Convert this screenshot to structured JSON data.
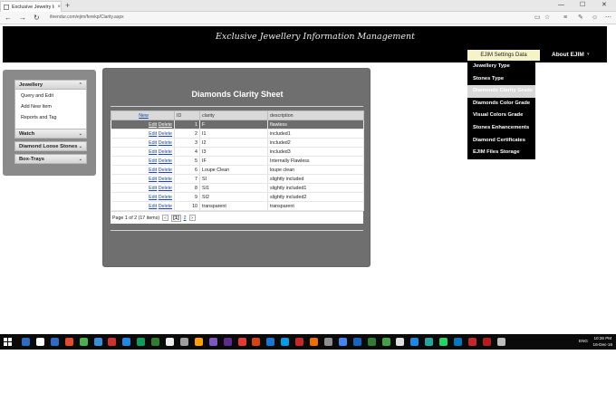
{
  "browser": {
    "tab_title": "Exclusive Jewelry Inform",
    "tab_close": "×",
    "new_tab": "+",
    "url": "ifeendur.com/ejim/ferekp/Clarity.aspx",
    "win_min": "—",
    "win_max": "☐",
    "win_close": "✕",
    "back": "←",
    "forward": "→",
    "refresh": "↻"
  },
  "header": {
    "site_title": "Exclusive Jewellery Information Management",
    "menu_settings": "EJIM Settings Data",
    "menu_about": "About EJIM",
    "menu_about_arrow": "▾"
  },
  "dropdown": {
    "items": [
      "Jewellery Type",
      "Stones Type",
      "Diamonds Clarity Grade",
      "Diamonds Color Grade",
      "Visual Colors Grade",
      "Stones Enhancements",
      "Diamond Certificates",
      "EJIM Files Storage"
    ],
    "selected_index": 2
  },
  "sidebar": {
    "jewellery": {
      "title": "Jewellery",
      "chevron": "⌃",
      "links": [
        "Query and Edit",
        "Add New Item",
        "Reports and Tag"
      ]
    },
    "watch": {
      "title": "Watch",
      "chevron": "⌄"
    },
    "loose": {
      "title": "Diamond Loose Stones",
      "chevron": "⌄"
    },
    "box": {
      "title": "Box-Trays",
      "chevron": "⌄"
    }
  },
  "panel": {
    "title": "Diamonds Clarity Sheet",
    "columns": {
      "new": "New",
      "id": "ID",
      "clarity": "clarity",
      "description": "description"
    },
    "edit_label": "Edit",
    "delete_label": "Delete",
    "rows": [
      {
        "id": "1",
        "clarity": "F",
        "description": "flawless"
      },
      {
        "id": "2",
        "clarity": "I1",
        "description": "included1"
      },
      {
        "id": "3",
        "clarity": "I2",
        "description": "included2"
      },
      {
        "id": "4",
        "clarity": "I3",
        "description": "included3"
      },
      {
        "id": "5",
        "clarity": "IF",
        "description": "Internally Flawless"
      },
      {
        "id": "6",
        "clarity": "Loupe Clean",
        "description": "loupe clean"
      },
      {
        "id": "7",
        "clarity": "SI",
        "description": "slightly included"
      },
      {
        "id": "8",
        "clarity": "SI1",
        "description": "slightly included1"
      },
      {
        "id": "9",
        "clarity": "SI2",
        "description": "slightly included2"
      },
      {
        "id": "10",
        "clarity": "transparent",
        "description": "transparent"
      }
    ],
    "selected_row": 0,
    "pager": {
      "summary": "Page 1 of 2 (17 items)",
      "prev": "<",
      "current": "[1]",
      "page2": "2",
      "next": ">"
    }
  },
  "taskbar": {
    "clock_time": "10:26 PM",
    "clock_date": "16-Dec-16",
    "lang": "ENG",
    "icon_colors": [
      "#2b6cc4",
      "#ffffff",
      "#2b6cc4",
      "#e34c26",
      "#4caf50",
      "#3b8edb",
      "#d32f2f",
      "#1e88e5",
      "#0f9d58",
      "#2e7d32",
      "#eeeeee",
      "#9e9e9e",
      "#ffa000",
      "#7e57c2",
      "#5c2d91",
      "#e53935",
      "#d84315",
      "#1976d2",
      "#039be5",
      "#c62828",
      "#ef6c00",
      "#8e8e8e",
      "#4285f4",
      "#1565c0",
      "#2e7d32",
      "#43a047",
      "#e0e0e0",
      "#1e88e5",
      "#26a69a",
      "#25d366",
      "#0277bd",
      "#c62828",
      "#b71c1c",
      "#bdbdbd"
    ]
  }
}
